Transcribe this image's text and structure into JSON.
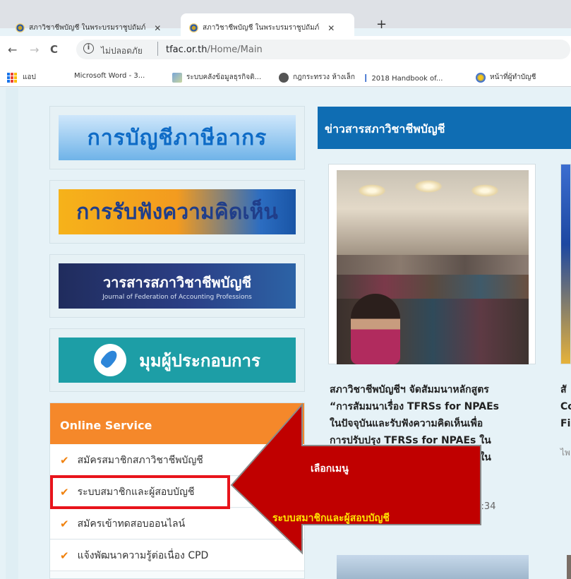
{
  "browser": {
    "tabs": [
      {
        "label": "สภาวิชาชีพบัญชี ในพระบรมราชูปถัมภ์",
        "close": "✕"
      },
      {
        "label": "สภาวิชาชีพบัญชี ในพระบรมราชูปถัมภ์",
        "close": "✕"
      }
    ],
    "new_tab": "+",
    "nav": {
      "back": "←",
      "forward": "→",
      "reload": "C"
    },
    "address": {
      "security_text": "ไม่ปลอดภัย",
      "security_icon": "i",
      "domain": "tfac.or.th",
      "path": "/Home/Main"
    },
    "bookmarks": [
      {
        "label": "แอป",
        "icon": "apps-icon"
      },
      {
        "label": "Microsoft Word - 3...",
        "icon": "none"
      },
      {
        "label": "ระบบคลังข้อมูลธุรกิจติ...",
        "icon": "image-icon"
      },
      {
        "label": "กฎกระทรวง ห้างเล็ก",
        "icon": "globe-icon"
      },
      {
        "label": "2018 Handbook of...",
        "icon": "text-cursor-icon"
      },
      {
        "label": "หน้าที่ผู้ทำบัญชี",
        "icon": "ball-icon"
      }
    ]
  },
  "sidebar": {
    "banners": [
      {
        "text": "การบัญชีภาษีอากร"
      },
      {
        "text": "การรับฟังความคิดเห็น"
      },
      {
        "text": "วารสารสภาวิชาชีพบัญชี",
        "subtext": "Journal of Federation of Accounting Professions"
      },
      {
        "text": "มุมผู้ประกอบการ"
      }
    ],
    "online_service": {
      "title": "Online Service",
      "items": [
        {
          "label": "สมัครสมาชิกสภาวิชาชีพบัญชี"
        },
        {
          "label": "ระบบสมาชิกและผู้สอบบัญชี"
        },
        {
          "label": "สมัครเข้าทดสอบออนไลน์"
        },
        {
          "label": "แจ้งพัฒนาความรู้ต่อเนื่อง CPD"
        }
      ],
      "check_glyph": "✔"
    }
  },
  "news": {
    "title": "ข่าวสารสภาวิชาชีพบัญชี",
    "card": {
      "lines": [
        "สภาวิชาชีพบัญชีฯ จัดสัมมนาหลักสูตร",
        "“การสัมมนาเรื่อง TFRSs for NPAEs",
        "ในปัจจุบันและรับฟังความคิดเห็นเพื่อ",
        "การปรับปรุง TFRSs for NPAEs ใน",
        "ure” ใน"
      ],
      "time": "08:34"
    },
    "card2": {
      "lines": [
        "สั",
        "Co",
        "Fi"
      ],
      "sub": "ไพ"
    }
  },
  "annotation": {
    "line1": "เลือกเมนู",
    "line2": "ระบบสมาชิกและผู้สอบบัญชี",
    "arrow_color": "#c00000",
    "highlight_color": "#e8141b"
  }
}
